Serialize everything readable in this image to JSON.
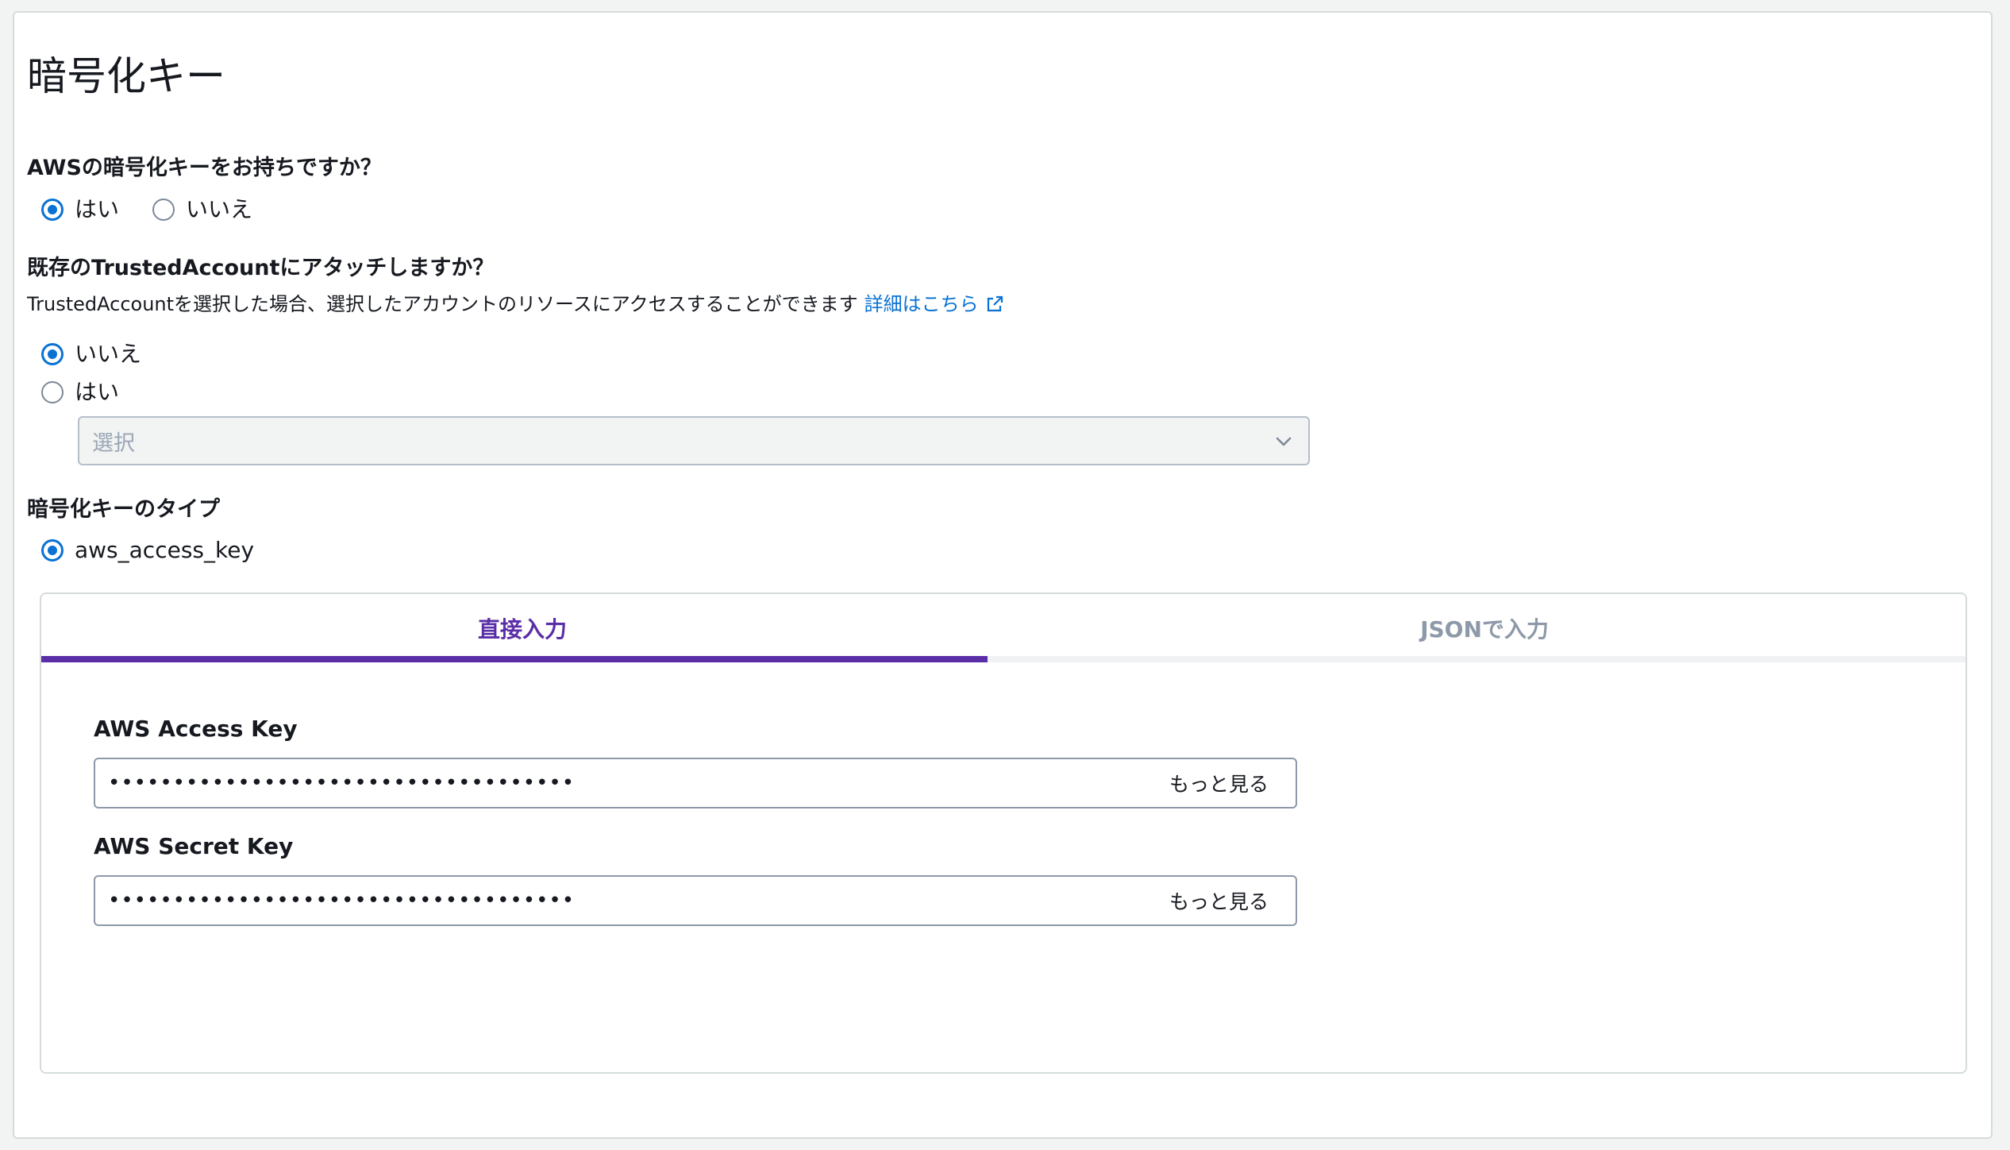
{
  "page": {
    "title": "暗号化キー"
  },
  "aws_key_question": {
    "label": "AWSの暗号化キーをお持ちですか？",
    "options": [
      {
        "label": "はい",
        "checked": true
      },
      {
        "label": "いいえ",
        "checked": false
      }
    ]
  },
  "trusted_account": {
    "label": "既存のTrustedAccountにアタッチしますか？",
    "help_text": "TrustedAccountを選択した場合、選択したアカウントのリソースにアクセスすることができます",
    "help_link": "詳細はこちら",
    "options": [
      {
        "label": "いいえ",
        "checked": true
      },
      {
        "label": "はい",
        "checked": false
      }
    ],
    "select_placeholder": "選択"
  },
  "key_type": {
    "label": "暗号化キーのタイプ",
    "options": [
      {
        "label": "aws_access_key",
        "checked": true
      }
    ]
  },
  "tabs": [
    {
      "label": "直接入力",
      "active": true
    },
    {
      "label": "JSONで入力",
      "active": false
    }
  ],
  "fields": {
    "access_key": {
      "label": "AWS Access Key",
      "masked_value": "••••••••••••••••••••••••••••••••••••",
      "show_label": "もっと見る"
    },
    "secret_key": {
      "label": "AWS Secret Key",
      "masked_value": "••••••••••••••••••••••••••••••••••••",
      "show_label": "もっと見る"
    }
  },
  "colors": {
    "radio_checked": "#0972d3",
    "link": "#0972d3",
    "tab_active": "#5a2ea6",
    "tab_inactive": "#8d99a8"
  },
  "icons": {
    "external_link": "external-link-icon",
    "select_caret": "chevron-down-icon"
  }
}
